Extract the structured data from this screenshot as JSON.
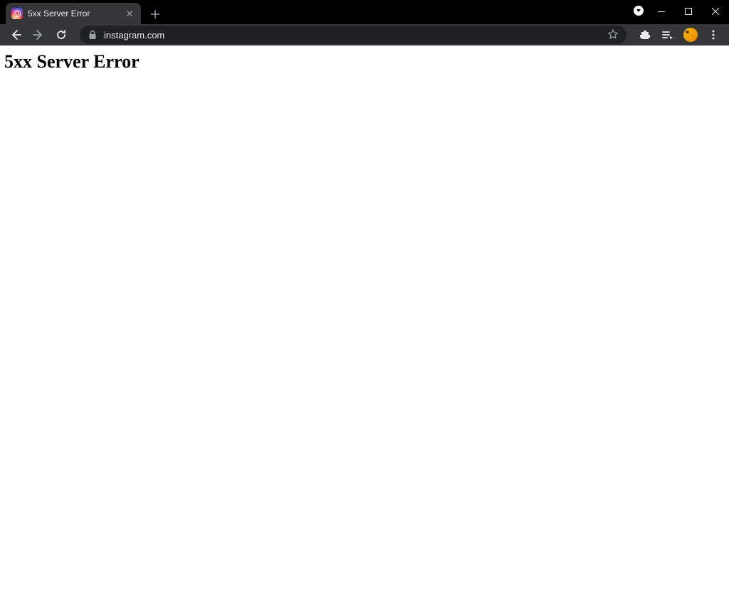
{
  "tab": {
    "title": "5xx Server Error"
  },
  "address": {
    "url": "instagram.com"
  },
  "page": {
    "heading": "5xx Server Error"
  }
}
